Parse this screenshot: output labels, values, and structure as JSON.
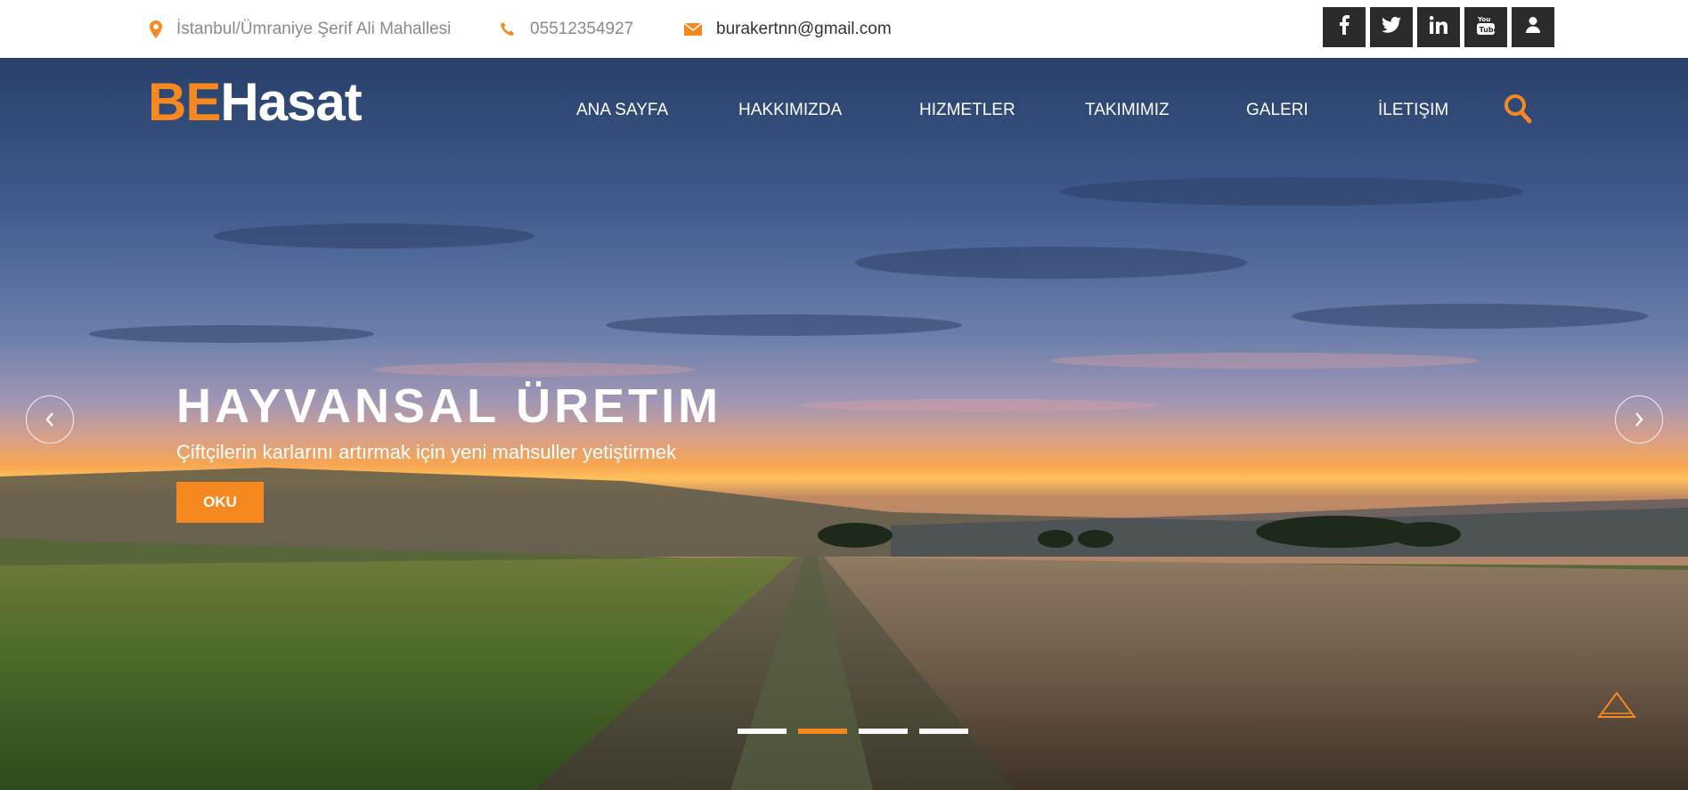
{
  "topbar": {
    "address": "İstanbul/Ümraniye Şerif Ali Mahallesi",
    "phone": "05512354927",
    "email": "burakertnn@gmail.com",
    "social": [
      {
        "icon": "facebook-icon"
      },
      {
        "icon": "twitter-icon"
      },
      {
        "icon": "linkedin-icon"
      },
      {
        "icon": "youtube-icon"
      },
      {
        "icon": "user-icon"
      }
    ]
  },
  "logo": {
    "accent": "BE",
    "rest": "Hasat"
  },
  "nav": {
    "items": [
      "ANA SAYFA",
      "HAKKIMIZDA",
      "HIZMETLER",
      "TAKIMIMIZ",
      "GALERI",
      "İLETIŞIM"
    ],
    "search_icon": "search-icon"
  },
  "slider": {
    "title": "HAYVANSAL ÜRETIM",
    "subtitle": "Çiftçilerin karlarını artırmak için yeni mahsuller yetiştirmek",
    "button": "OKU",
    "slide_count": 4,
    "active_slide": 2
  },
  "colors": {
    "accent": "#f5891f",
    "social_bg": "#2b2b2b"
  }
}
